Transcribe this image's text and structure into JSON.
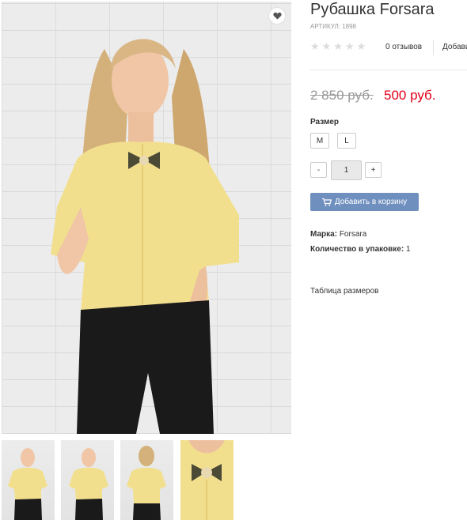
{
  "product": {
    "title": "Рубашка Forsara",
    "sku": "АРТИКУЛ: 1898",
    "rating_stars": 0,
    "reviews_label": "0 отзывов",
    "add_review_label": "Добавить отзыв",
    "old_price": "2 850 руб.",
    "new_price": "500 руб.",
    "size_label": "Размер",
    "sizes": [
      "M",
      "L"
    ],
    "quantity": {
      "minus": "-",
      "value": "1",
      "plus": "+"
    },
    "add_to_cart_label": "Добавить в корзину",
    "brand_label": "Марка:",
    "brand_value": "Forsara",
    "pack_label": "Количество в упаковке:",
    "pack_value": "1",
    "size_table_link": "Таблица размеров"
  },
  "gallery": {
    "thumbnail_count": 4
  },
  "icons": {
    "wishlist": "heart-icon",
    "rating": "star-icon",
    "cart": "cart-icon"
  },
  "colors": {
    "price_new": "#e1001a",
    "price_old": "#999999",
    "cart_button": "#6f8fbf",
    "star_empty": "#dcdcdc",
    "blouse": "#f2df8e",
    "jeans": "#1a1a1a"
  }
}
